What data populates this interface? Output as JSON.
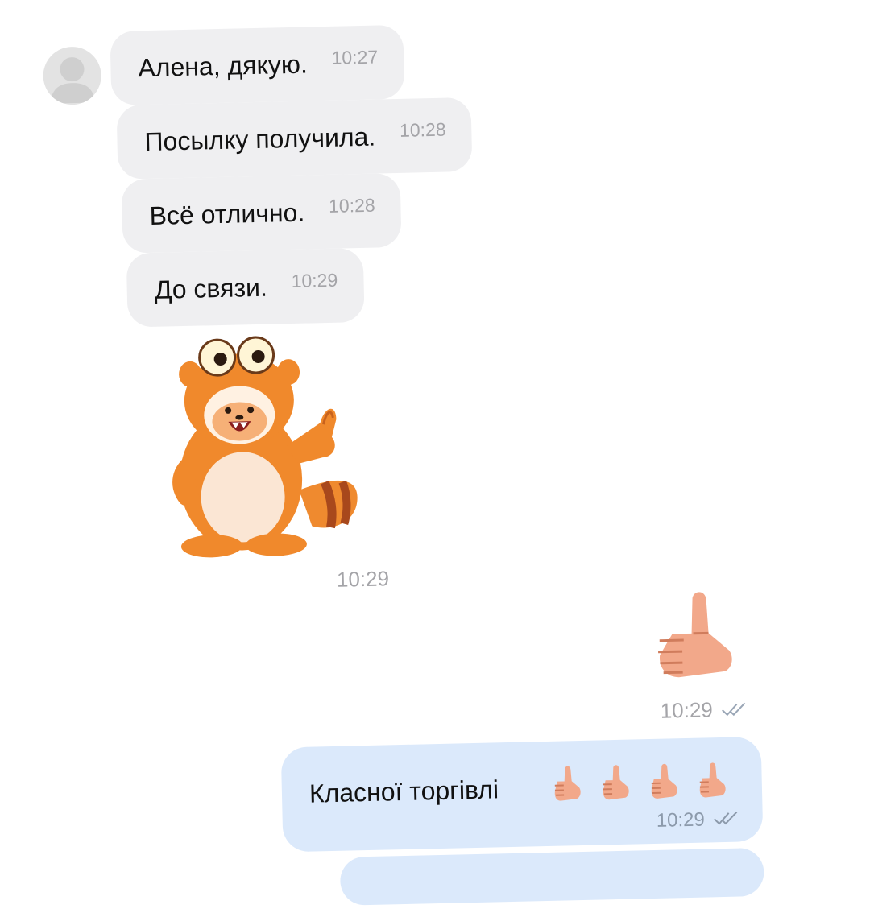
{
  "incoming": [
    {
      "text": "Алена, дякую.",
      "time": "10:27"
    },
    {
      "text": "Посылку получила.",
      "time": "10:28"
    },
    {
      "text": "Всё отлично.",
      "time": "10:28"
    },
    {
      "text": "До связи.",
      "time": "10:29"
    }
  ],
  "sticker_in": {
    "name": "raccoon-thumbs-up-sticker",
    "time": "10:29"
  },
  "sticker_out": {
    "name": "thumbs-up-sticker",
    "time": "10:29"
  },
  "outgoing": {
    "text": "Класної торгівлі",
    "emojis": [
      "thumbs-up",
      "thumbs-up",
      "thumbs-up",
      "thumbs-up"
    ],
    "time": "10:29"
  },
  "colors": {
    "incoming_bubble": "#efeff1",
    "outgoing_bubble": "#dbe9fb",
    "raccoon": "#f0892c"
  }
}
